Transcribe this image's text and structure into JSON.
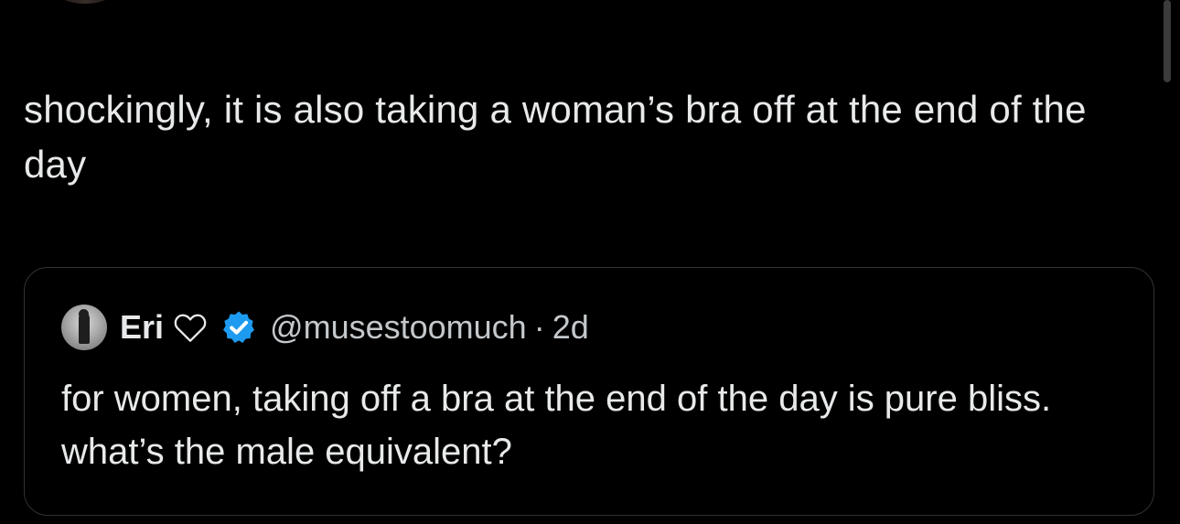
{
  "tweet": {
    "text": "shockingly, it is also taking a woman’s bra off at the end of the day"
  },
  "quote": {
    "display_name": "Eri",
    "handle": "@musestoomuch",
    "separator": "·",
    "timestamp": "2d",
    "text": "for women, taking off a bra at the end of the day is pure bliss. what’s the male equivalent?",
    "avatar_icon": "avatar-icon",
    "name_emoji_icon": "heart-outline-icon",
    "badge_icon": "verified-badge-icon"
  },
  "colors": {
    "background": "#000000",
    "text_primary": "#e7e9ea",
    "text_secondary": "#c4c8cb",
    "border": "#2f3336",
    "verified_blue": "#1d9bf0"
  }
}
